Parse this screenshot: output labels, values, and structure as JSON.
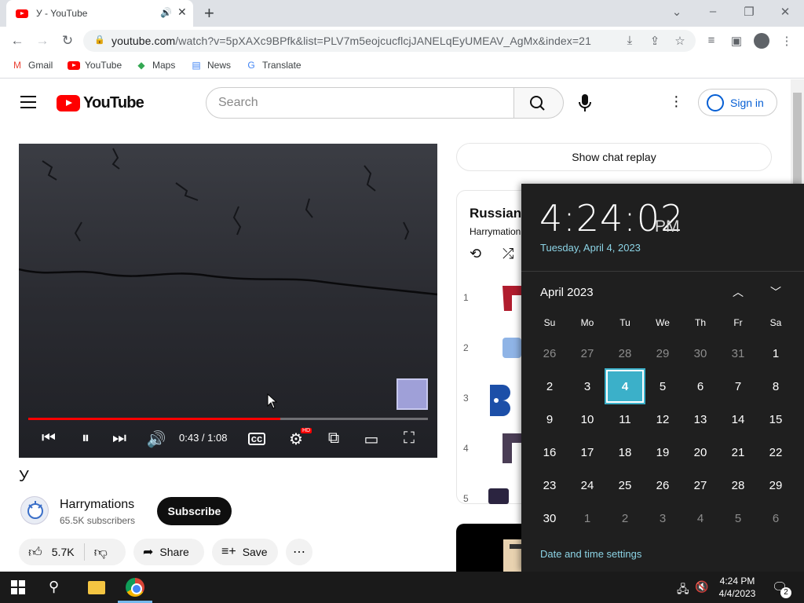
{
  "browser": {
    "tab_title": "У - YouTube",
    "url_domain": "youtube.com",
    "url_rest": "/watch?v=5pXAXc9BPfk&list=PLV7m5eojcucflcjJANELqEyUMEAV_AgMx&index=21",
    "bookmarks": [
      "Gmail",
      "YouTube",
      "Maps",
      "News",
      "Translate"
    ]
  },
  "youtube": {
    "search_placeholder": "Search",
    "sign_in_label": "Sign in",
    "chat_replay_label": "Show chat replay",
    "player": {
      "timecode": "0:43 / 1:08",
      "progress_fraction": 0.63
    },
    "video_title": "У",
    "channel_name": "Harrymations",
    "channel_subscribers": "65.5K subscribers",
    "subscribe_label": "Subscribe",
    "like_count": "5.7K",
    "share_label": "Share",
    "save_label": "Save",
    "playlist": {
      "title": "Russian",
      "owner": "Harrymation",
      "items": [
        "1",
        "2",
        "3",
        "4",
        "5"
      ]
    }
  },
  "clock_flyout": {
    "time": "4:24:02",
    "ampm": "PM",
    "date": "Tuesday, April 4, 2023",
    "month_label": "April 2023",
    "weekdays": [
      "Su",
      "Mo",
      "Tu",
      "We",
      "Th",
      "Fr",
      "Sa"
    ],
    "days": [
      [
        "26",
        "27",
        "28",
        "29",
        "30",
        "31",
        "1"
      ],
      [
        "2",
        "3",
        "4",
        "5",
        "6",
        "7",
        "8"
      ],
      [
        "9",
        "10",
        "11",
        "12",
        "13",
        "14",
        "15"
      ],
      [
        "16",
        "17",
        "18",
        "19",
        "20",
        "21",
        "22"
      ],
      [
        "23",
        "24",
        "25",
        "26",
        "27",
        "28",
        "29"
      ],
      [
        "30",
        "1",
        "2",
        "3",
        "4",
        "5",
        "6"
      ]
    ],
    "settings_link": "Date and time settings"
  },
  "taskbar": {
    "time": "4:24 PM",
    "date": "4/4/2023",
    "notification_count": "2"
  },
  "colors": {
    "accent_today": "#3bb0c9",
    "date_text": "#8cd4e6",
    "youtube_red": "#ff0000"
  }
}
